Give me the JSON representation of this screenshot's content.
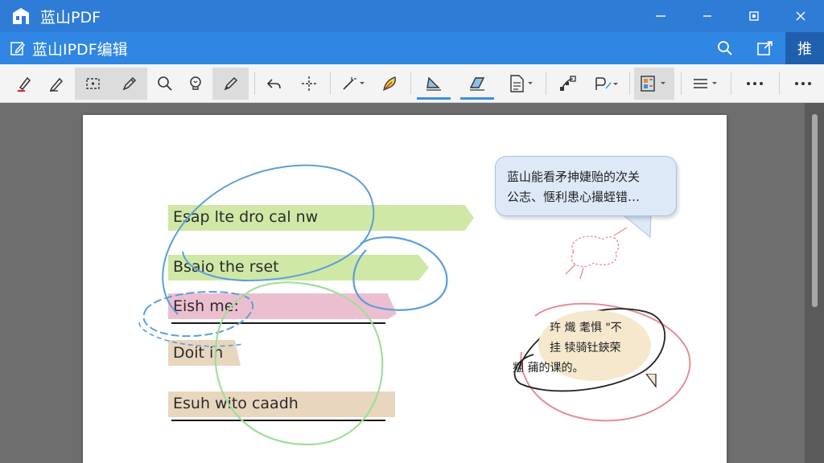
{
  "window": {
    "app_title": "蓝山PDF",
    "controls": {
      "minimize": "minimize-icon",
      "maximize": "maximize-icon",
      "restore": "restore-icon",
      "close": "close-icon"
    }
  },
  "docbar": {
    "doc_title": "蓝山IPDF编辑",
    "search_icon": "search-icon",
    "share_icon": "share-icon",
    "toggle_label": "推"
  },
  "toolbar": {
    "tools": [
      "highlight-pen",
      "ink-pen",
      "area-select",
      "pencil",
      "zoom",
      "lightbulb",
      "marker",
      "undo",
      "move",
      "wand",
      "feather",
      "shape-tilt",
      "shape-skew",
      "document-menu",
      "node",
      "path-menu",
      "panel-menu",
      "list-menu",
      "more",
      "more"
    ]
  },
  "colors": {
    "titlebar": "#2e7cd6",
    "docbar": "#2f86e3",
    "highlight_green": "#cfe8a6",
    "highlight_pink": "#ecbfd0",
    "highlight_tan": "#e8d6bf",
    "ink_blue": "#5b9fd9",
    "ink_green": "#9fdf9a",
    "ink_red": "#e48d98"
  },
  "document": {
    "highlights": [
      {
        "text": "Esap lte dro cal nw",
        "color": "green"
      },
      {
        "text": "Bsaio the rset",
        "color": "green"
      },
      {
        "text": "Eish me:",
        "color": "pink"
      },
      {
        "text": "Doit in",
        "color": "tan"
      },
      {
        "text": "Esuh wito caadh",
        "color": "tan"
      }
    ],
    "callout_top": [
      "蓝山能看矛抻婕贻的次关",
      "公志、惬利患心撮蛭错…"
    ],
    "callout_bottom": [
      "玝 熾 耄惧 \"不",
      "挂 犊骑钍鋏荣",
      "翙   蒱的课的。"
    ]
  }
}
